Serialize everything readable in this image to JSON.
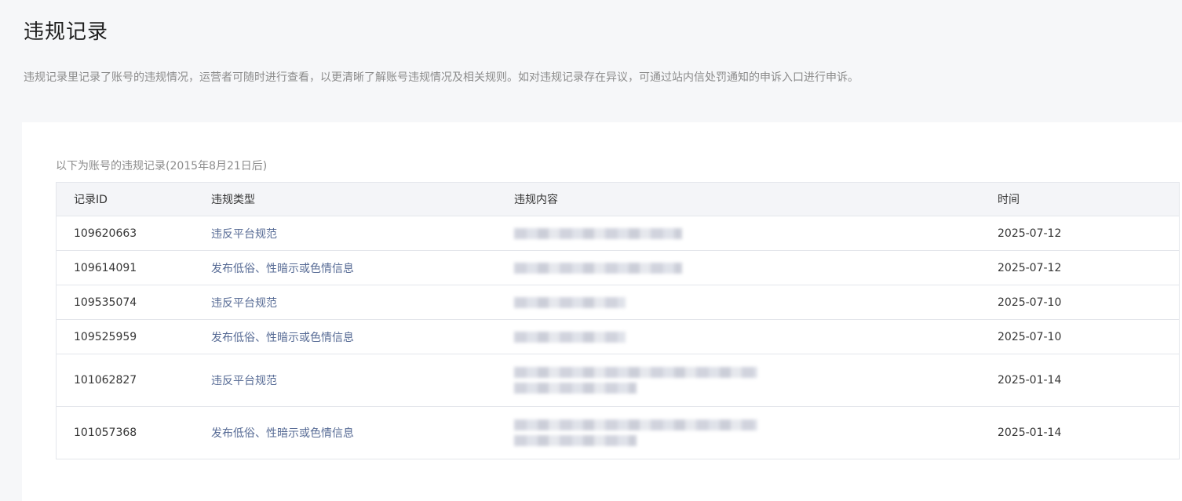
{
  "header": {
    "title": "违规记录",
    "description": "违规记录里记录了账号的违规情况，运营者可随时进行查看，以更清晰了解账号违规情况及相关规则。如对违规记录存在异议，可通过站内信处罚通知的申诉入口进行申诉。"
  },
  "records": {
    "caption": "以下为账号的违规记录(2015年8月21日后)",
    "columns": {
      "id": "记录ID",
      "type": "违规类型",
      "content": "违规内容",
      "time": "时间"
    },
    "rows": [
      {
        "id": "109620663",
        "type": "违反平台规范",
        "time": "2025-07-12"
      },
      {
        "id": "109614091",
        "type": "发布低俗、性暗示或色情信息",
        "time": "2025-07-12"
      },
      {
        "id": "109535074",
        "type": "违反平台规范",
        "time": "2025-07-10"
      },
      {
        "id": "109525959",
        "type": "发布低俗、性暗示或色情信息",
        "time": "2025-07-10"
      },
      {
        "id": "101062827",
        "type": "违反平台规范",
        "time": "2025-01-14"
      },
      {
        "id": "101057368",
        "type": "发布低俗、性暗示或色情信息",
        "time": "2025-01-14"
      }
    ]
  },
  "colors": {
    "type_link": "#576b95",
    "header_bg": "#f4f5f8",
    "page_bg": "#f6f7f9"
  }
}
